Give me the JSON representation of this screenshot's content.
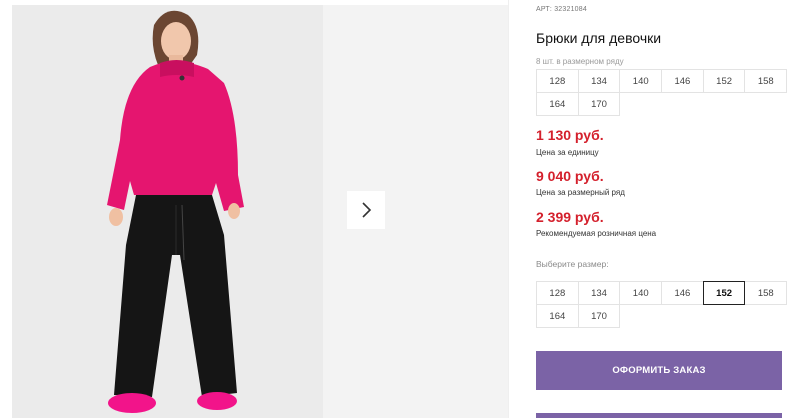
{
  "product": {
    "article_label": "АРТ:",
    "article_number": "32321084",
    "title": "Брюки для девочки",
    "pack_info": "8 шт. в размерном ряду"
  },
  "size_row": [
    "128",
    "134",
    "140",
    "146",
    "152",
    "158",
    "164",
    "170"
  ],
  "prices": [
    {
      "value": "1 130 руб.",
      "label": "Цена за единицу"
    },
    {
      "value": "9 040 руб.",
      "label": "Цена за размерный ряд"
    },
    {
      "value": "2 399 руб.",
      "label": "Рекомендуемая розничная цена"
    }
  ],
  "size_select": {
    "label": "Выберите размер:",
    "options": [
      "128",
      "134",
      "140",
      "146",
      "152",
      "158",
      "164",
      "170"
    ],
    "selected": "152"
  },
  "order_button": "ОФОРМИТЬ ЗАКАЗ",
  "gallery": {
    "next_icon": "chevron-right-icon"
  },
  "colors": {
    "price": "#d4202c",
    "button": "#7b63a6",
    "sweater": "#e5156f"
  }
}
